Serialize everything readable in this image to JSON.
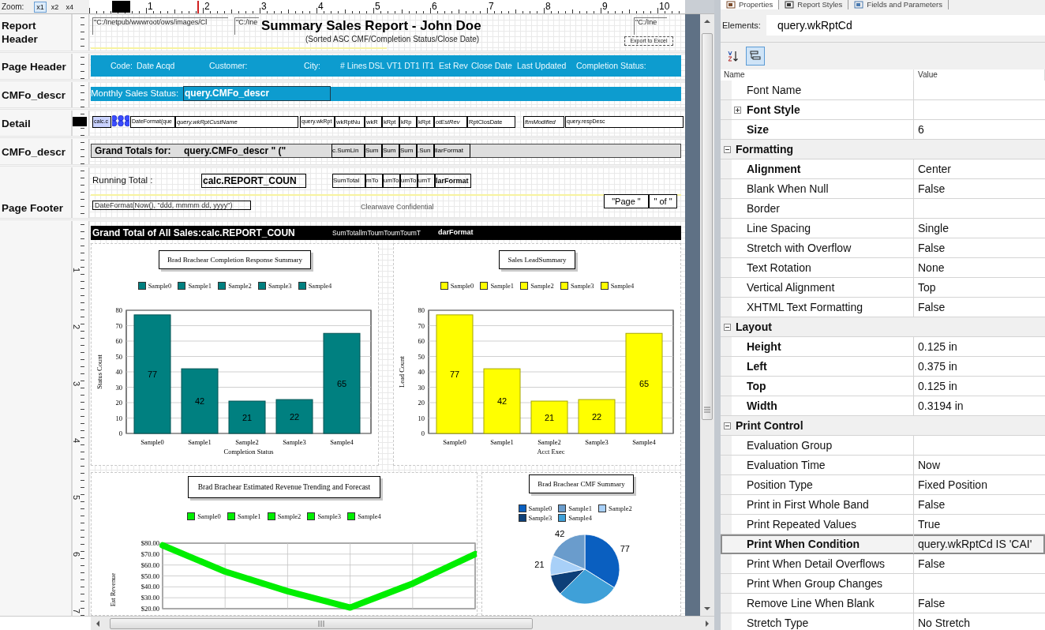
{
  "toolbar": {
    "zoom_label": "Zoom:",
    "zoom_levels": [
      {
        "label": "x1",
        "selected": true
      },
      {
        "label": "x2",
        "selected": false
      },
      {
        "label": "x4",
        "selected": false
      }
    ]
  },
  "ruler": [
    "1",
    "2",
    "3",
    "4",
    "5",
    "6",
    "7",
    "8",
    "9",
    "10"
  ],
  "bands": [
    {
      "kind": "report-header",
      "label": "Report Header",
      "elements": [
        {
          "kind": "path",
          "text": "\"C:/Inetpub/wwwroot/ows/images/Cl"
        },
        {
          "kind": "path",
          "text": "\"C:/Ine"
        },
        {
          "kind": "title",
          "text": "Summary Sales Report - John Doe"
        },
        {
          "kind": "subtitle",
          "text": "(Sorted ASC CMF/Completion Status/Close Date)"
        },
        {
          "kind": "path",
          "text": "\"C:/Ine"
        },
        {
          "kind": "tiny-box",
          "text": "Export to Excel"
        }
      ]
    },
    {
      "kind": "page-header",
      "label": "Page Header",
      "elements": [
        {
          "kind": "header-text",
          "text": "Code:"
        },
        {
          "kind": "header-text",
          "text": "Date Acqd"
        },
        {
          "kind": "header-text",
          "text": "Customer:"
        },
        {
          "kind": "header-text",
          "text": "City:"
        },
        {
          "kind": "header-text",
          "text": "# Lines"
        },
        {
          "kind": "header-text",
          "text": "DSL VT1 DT1 IT1"
        },
        {
          "kind": "header-text",
          "text": "Est Rev"
        },
        {
          "kind": "header-text",
          "text": "Close Date"
        },
        {
          "kind": "header-text",
          "text": "Last Updated"
        },
        {
          "kind": "header-text",
          "text": "Completion Status:"
        }
      ]
    },
    {
      "kind": "group-header",
      "label": "CMFo_descr",
      "elements": [
        {
          "kind": "bar-text",
          "text": "Monthly Sales Status:"
        },
        {
          "kind": "bar-field",
          "text": "query.CMFo_descr"
        }
      ]
    },
    {
      "kind": "detail",
      "label": "Detail",
      "elements": [
        {
          "kind": "field",
          "text": "calc.c",
          "selected": true
        },
        {
          "kind": "field",
          "text": "DateFormat(que",
          "selected": false
        },
        {
          "kind": "field-italic",
          "text": "query.wkRptCustName",
          "selected": false
        },
        {
          "kind": "field",
          "text": "query.wkRpt",
          "selected": false
        },
        {
          "kind": "field-mid",
          "text": "wkRptNu",
          "selected": false
        },
        {
          "kind": "field-mid",
          "text": "wkR",
          "selected": false
        },
        {
          "kind": "field-mid",
          "text": "kRpt",
          "selected": false
        },
        {
          "kind": "field-mid",
          "text": "kRp",
          "selected": false
        },
        {
          "kind": "field-mid",
          "text": "kRpt",
          "selected": false
        },
        {
          "kind": "field-italic",
          "text": "otEstRev",
          "selected": false
        },
        {
          "kind": "field-mid",
          "text": "RptClosDate",
          "selected": false
        },
        {
          "kind": "field-italic",
          "text": "ftmModified",
          "selected": false
        },
        {
          "kind": "field",
          "text": "query.respDesc",
          "selected": false
        }
      ]
    },
    {
      "kind": "group-footer",
      "label": "CMFo_descr",
      "elements": [
        {
          "kind": "bold-text",
          "text": "Grand Totals for:"
        },
        {
          "kind": "bold-text",
          "text": "query.CMFo_descr  \" (\""
        },
        {
          "kind": "sum-field",
          "text": "c.SumLin"
        },
        {
          "kind": "sum-field",
          "text": "Sum"
        },
        {
          "kind": "sum-field",
          "text": "Sum"
        },
        {
          "kind": "sum-field",
          "text": "Sum"
        },
        {
          "kind": "sum-field",
          "text": ".Sun"
        },
        {
          "kind": "sum-field",
          "text": "llarFormat"
        }
      ]
    },
    {
      "kind": "page-footer",
      "label": "Page Footer",
      "elements": [
        {
          "kind": "text",
          "text": "Running Total :"
        },
        {
          "kind": "bold-box",
          "text": "calc.REPORT_COUN"
        },
        {
          "kind": "sum-field",
          "text": "SumTotal"
        },
        {
          "kind": "sum-field",
          "text": "mTo"
        },
        {
          "kind": "sum-field",
          "text": "umTo"
        },
        {
          "kind": "sum-field",
          "text": "umTo"
        },
        {
          "kind": "sum-field",
          "text": "umT"
        },
        {
          "kind": "sum-bold",
          "text": "larFormat"
        },
        {
          "kind": "date-box",
          "text": "DateFormat(Now(), \"ddd, mmmm dd, yyyy\")"
        },
        {
          "kind": "muted-text",
          "text": "Clearwave Confidential"
        },
        {
          "kind": "page-box",
          "text": "\"Page \""
        },
        {
          "kind": "page-box",
          "text": "\" of \""
        }
      ]
    },
    {
      "kind": "summary",
      "vertical_ruler": [
        "1",
        "2",
        "3",
        "4",
        "5",
        "6",
        "7"
      ],
      "elements": [
        {
          "kind": "inverse-bold",
          "text": "Grand Total of All Sales:calc.REPORT_COUN"
        },
        {
          "kind": "inverse-text",
          "text": "SumTotallmToumToumToumT"
        },
        {
          "kind": "inverse-sum",
          "text": "darFormat"
        }
      ],
      "charts": [
        {
          "legend": [
            {
              "label": "Sample0",
              "color": "#008080"
            },
            {
              "label": "Sample1",
              "color": "#008080"
            },
            {
              "label": "Sample2",
              "color": "#008080"
            },
            {
              "label": "Sample3",
              "color": "#008080"
            },
            {
              "label": "Sample4",
              "color": "#008080"
            }
          ],
          "chart_data": {
            "type": "bar",
            "title": "Brad Brachear Completion Response Summary",
            "xlabel": "Completion Status",
            "ylabel": "Status Count",
            "categories": [
              "Sample0",
              "Sample1",
              "Sample2",
              "Sample3",
              "Sample4"
            ],
            "values": [
              77,
              42,
              21,
              22,
              65
            ],
            "grid": true,
            "ylim": [
              0,
              80
            ],
            "yticks": [
              0,
              10,
              20,
              30,
              40,
              50,
              60,
              70,
              80
            ],
            "value_labels": [
              "77",
              "42",
              "21",
              "22",
              "65"
            ]
          }
        },
        {
          "legend": [
            {
              "label": "Sample0",
              "color": "#ffff00"
            },
            {
              "label": "Sample1",
              "color": "#ffff00"
            },
            {
              "label": "Sample2",
              "color": "#ffff00"
            },
            {
              "label": "Sample3",
              "color": "#ffff00"
            },
            {
              "label": "Sample4",
              "color": "#ffff00"
            }
          ],
          "chart_data": {
            "type": "bar",
            "title": "Sales LeadSummary",
            "xlabel": "Acct Exec",
            "ylabel": "Lead Count",
            "categories": [
              "Sample0",
              "Sample1",
              "Sample2",
              "Sample3",
              "Sample4"
            ],
            "values": [
              77,
              42,
              21,
              22,
              65
            ],
            "grid": true,
            "ylim": [
              0,
              80
            ],
            "yticks": [
              0,
              10,
              20,
              30,
              40,
              50,
              60,
              70,
              80
            ],
            "value_labels": [
              "77",
              "42",
              "21",
              "22",
              "65"
            ]
          }
        },
        {
          "legend": [
            {
              "label": "Sample0",
              "color": "#00ee00"
            },
            {
              "label": "Sample1",
              "color": "#00ee00"
            },
            {
              "label": "Sample2",
              "color": "#00ee00"
            },
            {
              "label": "Sample3",
              "color": "#00ee00"
            },
            {
              "label": "Sample4",
              "color": "#00ee00"
            }
          ],
          "chart_data": {
            "type": "line",
            "title": "Brad Brachear Estimated Revenue Trending and Forecast",
            "ylabel": "Est Revenue",
            "values": [
              78,
              54,
              36,
              21,
              43,
              70
            ],
            "grid": true,
            "ylim": [
              20,
              80
            ],
            "yticks": [
              {
                "value": 20,
                "label": "$20.00"
              },
              {
                "value": 30,
                "label": "$30.00"
              },
              {
                "value": 40,
                "label": "$40.00"
              },
              {
                "value": 50,
                "label": "$50.00"
              },
              {
                "value": 60,
                "label": "$60.00"
              },
              {
                "value": 70,
                "label": "$70.00"
              },
              {
                "value": 80,
                "label": "$80.00"
              }
            ]
          }
        },
        {
          "legend": [
            {
              "label": "Sample0",
              "color": "#0a5fc0"
            },
            {
              "label": "Sample1",
              "color": "#6a9ccc"
            },
            {
              "label": "Sample2",
              "color": "#a8d0f8"
            },
            {
              "label": "Sample3",
              "color": "#0d3f78"
            },
            {
              "label": "Sample4",
              "color": "#3fa0d8"
            }
          ],
          "chart_data": {
            "type": "pie",
            "title": "Brad Brachear CMF Summary",
            "values": [
              77,
              42,
              21,
              22,
              65
            ],
            "value_labels": [
              "77",
              "42",
              "21",
              null,
              null
            ]
          }
        }
      ]
    }
  ],
  "properties_panel": {
    "tabs": [
      {
        "label": "Properties",
        "selected": true
      },
      {
        "label": "Report Styles",
        "selected": false
      },
      {
        "label": "Fields and Parameters",
        "selected": false
      }
    ],
    "elements_label": "Elements:",
    "element_value": "query.wkRptCd",
    "sort_buttons": [
      {
        "kind": "alphabetical",
        "selected": false
      },
      {
        "kind": "categorized",
        "selected": true
      }
    ],
    "columns": [
      "Name",
      "Value"
    ],
    "rows": [
      {
        "kind": "property",
        "name": "Font Name",
        "modified": false,
        "selected": false
      },
      {
        "kind": "property",
        "name": "Font Style",
        "modified": true,
        "selected": false,
        "expanded": false
      },
      {
        "kind": "property",
        "name": "Size",
        "value": "6",
        "modified": true,
        "selected": false
      },
      {
        "kind": "category",
        "name": "Formatting",
        "expanded": true
      },
      {
        "kind": "property",
        "name": "Alignment",
        "value": "Center",
        "modified": true,
        "selected": false
      },
      {
        "kind": "property",
        "name": "Blank When Null",
        "value": "False",
        "modified": false,
        "selected": false
      },
      {
        "kind": "property",
        "name": "Border",
        "modified": false,
        "selected": false
      },
      {
        "kind": "property",
        "name": "Line Spacing",
        "value": "Single",
        "modified": false,
        "selected": false
      },
      {
        "kind": "property",
        "name": "Stretch with Overflow",
        "value": "False",
        "modified": false,
        "selected": false
      },
      {
        "kind": "property",
        "name": "Text Rotation",
        "value": "None",
        "modified": false,
        "selected": false
      },
      {
        "kind": "property",
        "name": "Vertical Alignment",
        "value": "Top",
        "modified": false,
        "selected": false
      },
      {
        "kind": "property",
        "name": "XHTML Text Formatting",
        "value": "False",
        "modified": false,
        "selected": false
      },
      {
        "kind": "category",
        "name": "Layout",
        "expanded": true
      },
      {
        "kind": "property",
        "name": "Height",
        "value": "0.125 in",
        "modified": true,
        "selected": false
      },
      {
        "kind": "property",
        "name": "Left",
        "value": "0.375 in",
        "modified": true,
        "selected": false
      },
      {
        "kind": "property",
        "name": "Top",
        "value": "0.125 in",
        "modified": true,
        "selected": false
      },
      {
        "kind": "property",
        "name": "Width",
        "value": "0.3194 in",
        "modified": true,
        "selected": false
      },
      {
        "kind": "category",
        "name": "Print Control",
        "expanded": true
      },
      {
        "kind": "property",
        "name": "Evaluation Group",
        "modified": false,
        "selected": false
      },
      {
        "kind": "property",
        "name": "Evaluation Time",
        "value": "Now",
        "modified": false,
        "selected": false
      },
      {
        "kind": "property",
        "name": "Position Type",
        "value": "Fixed Position",
        "modified": false,
        "selected": false
      },
      {
        "kind": "property",
        "name": "Print in First Whole Band",
        "value": "False",
        "modified": false,
        "selected": false
      },
      {
        "kind": "property",
        "name": "Print Repeated Values",
        "value": "True",
        "modified": false,
        "selected": false
      },
      {
        "kind": "property",
        "name": "Print When Condition",
        "value": "query.wkRptCd IS 'CAI'",
        "modified": true,
        "selected": true
      },
      {
        "kind": "property",
        "name": "Print When Detail Overflows",
        "value": "False",
        "modified": false,
        "selected": false
      },
      {
        "kind": "property",
        "name": "Print When Group Changes",
        "modified": false,
        "selected": false
      },
      {
        "kind": "property",
        "name": "Remove Line When Blank",
        "value": "False",
        "modified": false,
        "selected": false
      },
      {
        "kind": "property",
        "name": "Stretch Type",
        "value": "No Stretch",
        "modified": false,
        "selected": false
      }
    ]
  }
}
